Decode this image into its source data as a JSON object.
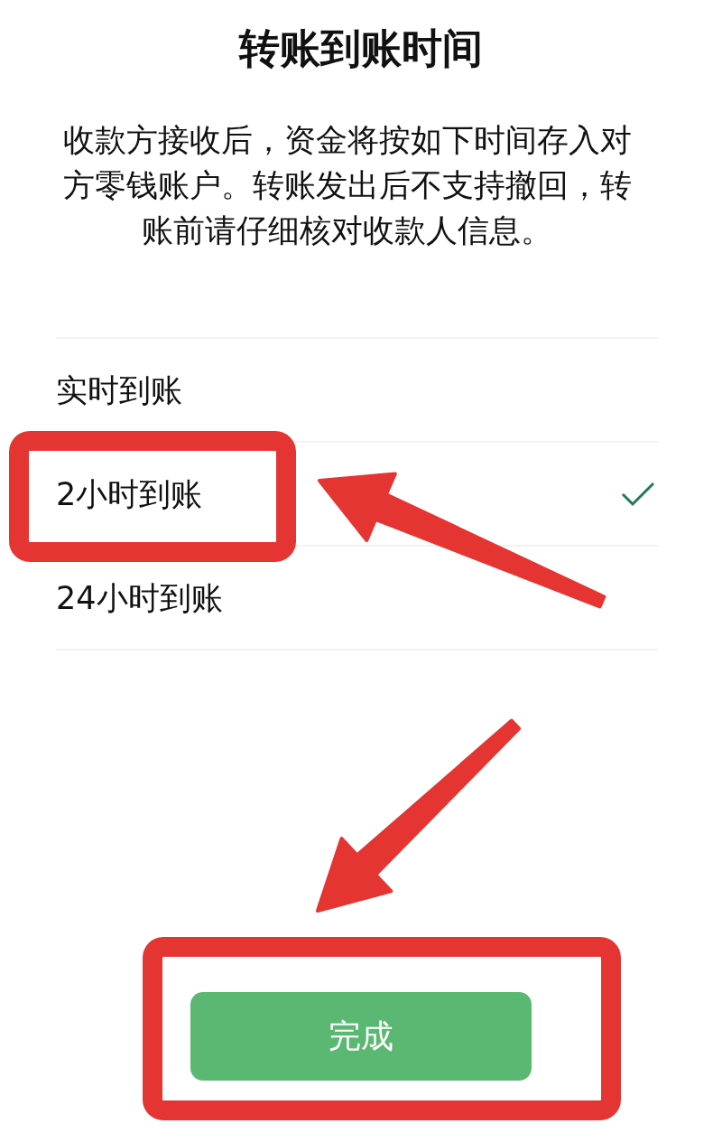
{
  "title": "转账到账时间",
  "description": "收款方接收后，资金将按如下时间存入对方零钱账户。转账发出后不支持撤回，转账前请仔细核对收款人信息。",
  "options": [
    {
      "label": "实时到账",
      "selected": false
    },
    {
      "label": "2小时到账",
      "selected": true
    },
    {
      "label": "24小时到账",
      "selected": false
    }
  ],
  "done_button": {
    "label": "完成"
  },
  "annotations": [
    {
      "kind": "frame"
    },
    {
      "kind": "arrow"
    },
    {
      "kind": "arrow"
    },
    {
      "kind": "frame"
    }
  ]
}
